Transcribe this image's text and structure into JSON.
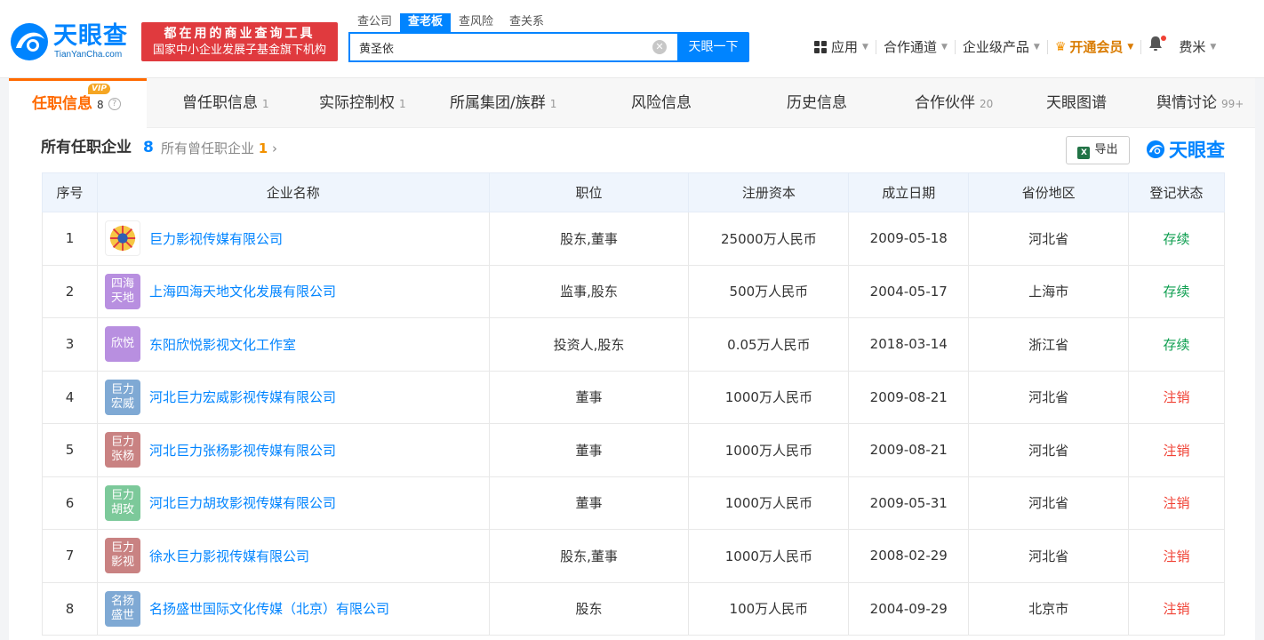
{
  "header": {
    "logo_cn": "天眼查",
    "logo_en": "TianYanCha.com",
    "promo_line1": "都在用的商业查询工具",
    "promo_line2": "国家中小企业发展子基金旗下机构",
    "search_tabs": [
      "查公司",
      "查老板",
      "查风险",
      "查关系"
    ],
    "search_value": "黄圣依",
    "search_button": "天眼一下",
    "nav": {
      "apps": "应用",
      "channel": "合作通道",
      "enterprise": "企业级产品",
      "vip": "开通会员",
      "user": "费米"
    },
    "colors": {
      "brand": "#0084ff",
      "promo": "#e03a3e",
      "vip": "#f29100"
    }
  },
  "tabs": [
    {
      "label": "任职信息",
      "count": "8",
      "badge": "VIP"
    },
    {
      "label": "曾任职信息",
      "count": "1"
    },
    {
      "label": "实际控制权",
      "count": "1"
    },
    {
      "label": "所属集团/族群",
      "count": "1"
    },
    {
      "label": "风险信息",
      "count": ""
    },
    {
      "label": "历史信息",
      "count": ""
    },
    {
      "label": "合作伙伴",
      "count": "20"
    },
    {
      "label": "天眼图谱",
      "count": ""
    },
    {
      "label": "舆情讨论",
      "count": "99+"
    }
  ],
  "section": {
    "title": "所有任职企业",
    "count": "8",
    "sub_label": "所有曾任职企业",
    "sub_count": "1",
    "export": "导出",
    "brand": "天眼查"
  },
  "table": {
    "headers": [
      "序号",
      "企业名称",
      "职位",
      "注册资本",
      "成立日期",
      "省份地区",
      "登记状态"
    ],
    "rows": [
      {
        "no": "1",
        "logo": "",
        "logo_color": "",
        "name": "巨力影视传媒有限公司",
        "position": "股东,董事",
        "capital": "25000万人民币",
        "date": "2009-05-18",
        "region": "河北省",
        "status": "存续",
        "status_type": "ok"
      },
      {
        "no": "2",
        "logo": "四海天地",
        "logo_color": "#b88fe0",
        "name": "上海四海天地文化发展有限公司",
        "position": "监事,股东",
        "capital": "500万人民币",
        "date": "2004-05-17",
        "region": "上海市",
        "status": "存续",
        "status_type": "ok"
      },
      {
        "no": "3",
        "logo": "欣悦",
        "logo_color": "#b88fe0",
        "name": "东阳欣悦影视文化工作室",
        "position": "投资人,股东",
        "capital": "0.05万人民币",
        "date": "2018-03-14",
        "region": "浙江省",
        "status": "存续",
        "status_type": "ok"
      },
      {
        "no": "4",
        "logo": "巨力宏威",
        "logo_color": "#7fa9d4",
        "name": "河北巨力宏威影视传媒有限公司",
        "position": "董事",
        "capital": "1000万人民币",
        "date": "2009-08-21",
        "region": "河北省",
        "status": "注销",
        "status_type": "cancel"
      },
      {
        "no": "5",
        "logo": "巨力张杨",
        "logo_color": "#c98282",
        "name": "河北巨力张杨影视传媒有限公司",
        "position": "董事",
        "capital": "1000万人民币",
        "date": "2009-08-21",
        "region": "河北省",
        "status": "注销",
        "status_type": "cancel"
      },
      {
        "no": "6",
        "logo": "巨力胡玫",
        "logo_color": "#7cc99a",
        "name": "河北巨力胡玫影视传媒有限公司",
        "position": "董事",
        "capital": "1000万人民币",
        "date": "2009-05-31",
        "region": "河北省",
        "status": "注销",
        "status_type": "cancel"
      },
      {
        "no": "7",
        "logo": "巨力影视",
        "logo_color": "#c98282",
        "name": "徐水巨力影视传媒有限公司",
        "position": "股东,董事",
        "capital": "1000万人民币",
        "date": "2008-02-29",
        "region": "河北省",
        "status": "注销",
        "status_type": "cancel"
      },
      {
        "no": "8",
        "logo": "名扬盛世",
        "logo_color": "#7fa9d4",
        "name": "名扬盛世国际文化传媒（北京）有限公司",
        "position": "股东",
        "capital": "100万人民币",
        "date": "2004-09-29",
        "region": "北京市",
        "status": "注销",
        "status_type": "cancel"
      }
    ]
  }
}
